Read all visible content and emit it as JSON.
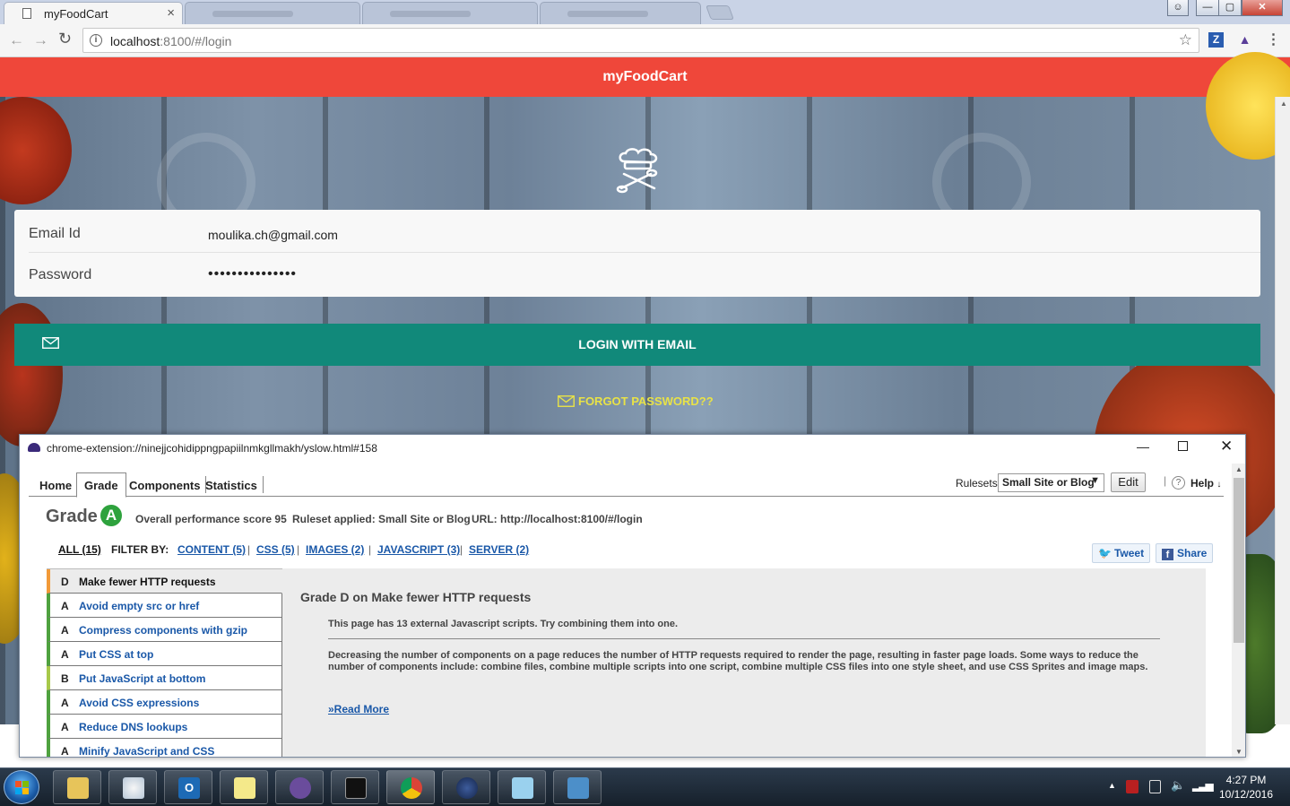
{
  "browser": {
    "active_tab_title": "myFoodCart",
    "tab_close": "×",
    "url_host": "localhost",
    "url_rest": ":8100/#/login",
    "star": "☆",
    "ext_z": "Z",
    "menu": "⋮"
  },
  "window_controls": {
    "minimize": "—",
    "maximize": "▢",
    "close": "✕"
  },
  "app": {
    "header_title": "myFoodCart",
    "email_label": "Email Id",
    "email_value": "moulika.ch@gmail.com",
    "password_label": "Password",
    "password_value": "•••••••••••••••",
    "login_button": "LOGIN WITH EMAIL",
    "forgot_link": "FORGOT PASSWORD??"
  },
  "yslow": {
    "window_url": "chrome-extension://ninejjcohidippngpapiilnmkgllmakh/yslow.html#158",
    "window_minimize": "—",
    "window_close": "✕",
    "tabs": [
      "Home",
      "Grade",
      "Components",
      "Statistics"
    ],
    "rulesets_label": "Rulesets",
    "ruleset_value": "Small Site or Blog",
    "ruleset_caret": "▼",
    "edit_button": "Edit",
    "help_q": "?",
    "help_label": "Help",
    "help_caret": "↓",
    "grade_word": "Grade",
    "grade_letter": "A",
    "overall_score": "Overall performance score 95",
    "ruleset_applied": "Ruleset applied: Small Site or Blog",
    "url_text": "URL: http://localhost:8100/#/login",
    "filters": {
      "all": "ALL (15)",
      "filter_by": "FILTER BY:",
      "content": "CONTENT (5)",
      "css": "CSS (5)",
      "images": "IMAGES (2)",
      "javascript": "JAVASCRIPT (3)",
      "server": "SERVER (2)",
      "sep": "|"
    },
    "tweet": "Tweet",
    "share": "Share",
    "fb_glyph": "f",
    "tw_glyph": "🐦",
    "rules": [
      {
        "grade": "D",
        "title": "Make fewer HTTP requests"
      },
      {
        "grade": "A",
        "title": "Avoid empty src or href"
      },
      {
        "grade": "A",
        "title": "Compress components with gzip"
      },
      {
        "grade": "A",
        "title": "Put CSS at top"
      },
      {
        "grade": "B",
        "title": "Put JavaScript at bottom"
      },
      {
        "grade": "A",
        "title": "Avoid CSS expressions"
      },
      {
        "grade": "A",
        "title": "Reduce DNS lookups"
      },
      {
        "grade": "A",
        "title": "Minify JavaScript and CSS"
      }
    ],
    "detail": {
      "heading": "Grade D on Make fewer HTTP requests",
      "summary": "This page has 13 external Javascript scripts. Try combining them into one.",
      "body": "Decreasing the number of components on a page reduces the number of HTTP requests required to render the page, resulting in faster page loads. Some ways to reduce the number of components include: combine files, combine multiple scripts into one script, combine multiple CSS files into one style sheet, and use CSS Sprites and image maps.",
      "read_more": "»Read More"
    }
  },
  "taskbar": {
    "outlook_label": "O",
    "time": "4:27 PM",
    "date": "10/12/2016",
    "tray_up": "▲"
  },
  "colors": {
    "app_header": "#ef473a",
    "login_button": "#11897a",
    "forgot_link": "#e8e247",
    "grade_badge": "#2ea23d"
  }
}
